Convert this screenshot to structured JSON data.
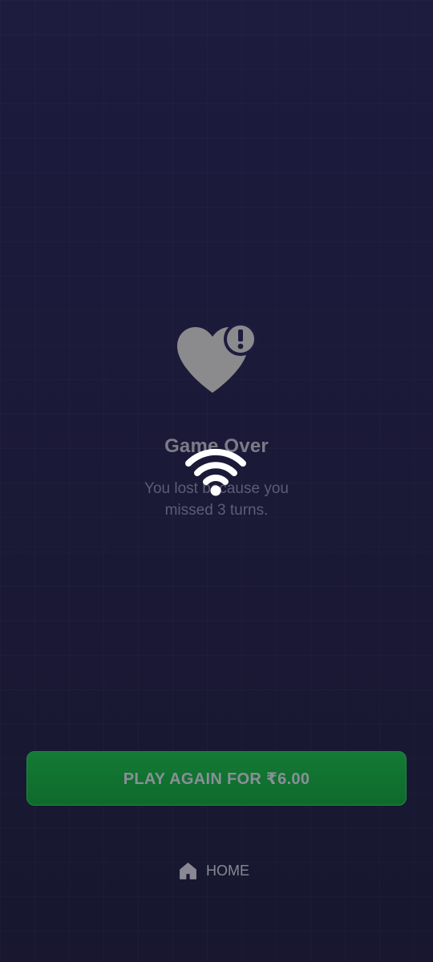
{
  "game_over": {
    "title": "Game Over",
    "message": "You lost because you missed 3 turns.",
    "status_icon": "heart-alert-icon",
    "overlay_icon": "wifi-icon"
  },
  "actions": {
    "play_again_label": "PLAY AGAIN FOR ₹6.00",
    "home_label": "HOME",
    "home_icon": "home-icon"
  },
  "colors": {
    "background": "#1d1b3e",
    "button_green": "#137a34",
    "muted_text": "#7c7b88",
    "wifi_white": "#ffffff"
  }
}
